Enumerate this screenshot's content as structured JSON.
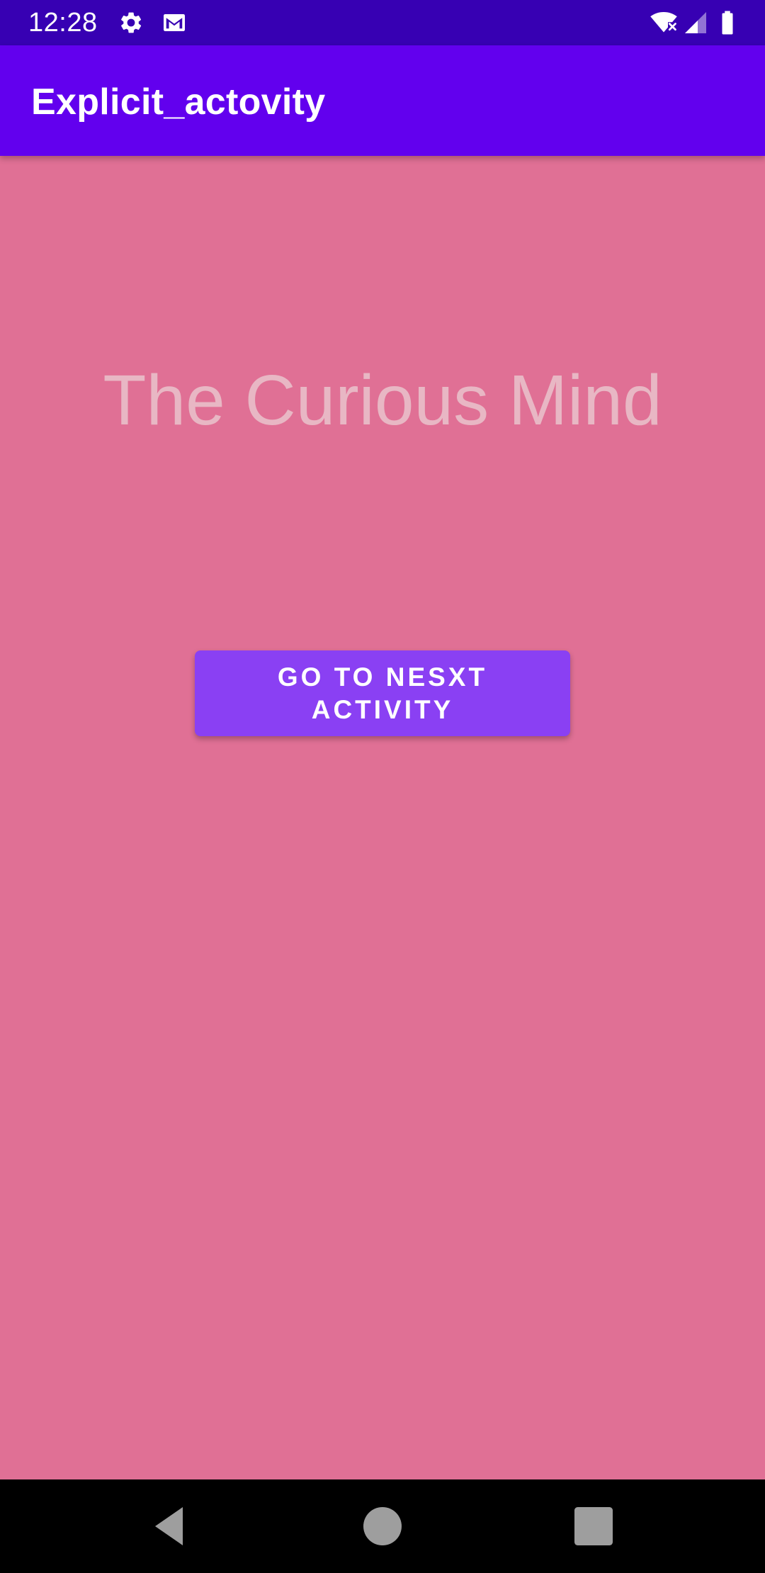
{
  "status_bar": {
    "time": "12:28",
    "left_icons": [
      "settings-icon",
      "gmail-icon"
    ],
    "right_icons": [
      "wifi-icon",
      "cell-signal-icon",
      "battery-icon"
    ],
    "background_color": "#3700B3"
  },
  "app_bar": {
    "title": "Explicit_actovity",
    "background_color": "#6200EE"
  },
  "main": {
    "background_color": "#E07095",
    "heading": "The Curious Mind",
    "heading_color": "#E8B7C4",
    "button_label": "GO TO NESXT ACTIVITY",
    "button_color": "#8A40F3"
  },
  "nav_bar": {
    "buttons": [
      "back-icon",
      "home-icon",
      "recents-icon"
    ]
  }
}
